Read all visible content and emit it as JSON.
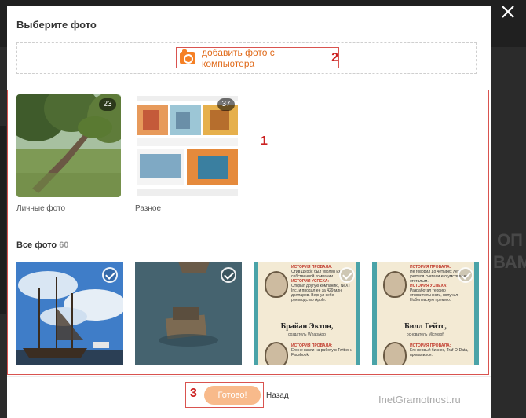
{
  "dialog": {
    "title": "Выберите фото",
    "upload_label": "добавить фото с компьютера",
    "upload_marker": "2",
    "area_marker": "1",
    "done_marker": "3",
    "done_label": "Готово!",
    "back_label": "Назад"
  },
  "albums": [
    {
      "name": "Личные фото",
      "count": "23"
    },
    {
      "name": "Разное",
      "count": "37"
    }
  ],
  "all_photos": {
    "title": "Все фото",
    "count": "60"
  },
  "infographics": [
    {
      "history_label": "ИСТОРИЯ ПРОВАЛА:",
      "history_text": "Стив Джобс был уволен из собственной компании.",
      "success_label": "ИСТОРИЯ УСПЕХА:",
      "success_text": "Открыл другую компанию, NeXT Inc, и продал ее за 429 млн долларов. Вернул себе руководство Apple.",
      "name": "Брайан Эктон,",
      "role": "создатель WhatsApp",
      "lower_label": "ИСТОРИЯ ПРОВАЛА:",
      "lower_text": "Его не взяли на работу в Twitter и Facebook."
    },
    {
      "history_label": "ИСТОРИЯ ПРОВАЛА:",
      "history_text": "Не говорил до четырех лет, учителя считали его умственно отсталым.",
      "success_label": "ИСТОРИЯ УСПЕХА:",
      "success_text": "Разработал теорию относительности, получил Нобелевскую премию.",
      "name": "Билл Гейтс,",
      "role": "основатель Microsoft",
      "lower_label": "ИСТОРИЯ ПРОВАЛА:",
      "lower_text": "Его первый бизнес, Traf-O-Data, провалился."
    }
  ],
  "background": {
    "right_text": "ОП ВАМ"
  },
  "watermark": "InetGramotnost.ru",
  "colors": {
    "accent": "#f58025",
    "button": "#f8ba8b",
    "marker": "#cc2222"
  }
}
